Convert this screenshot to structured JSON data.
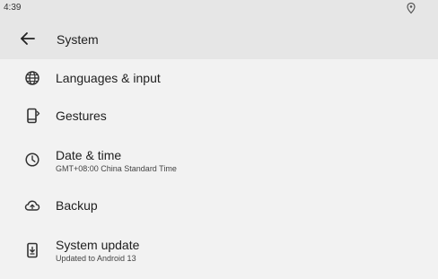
{
  "status_bar": {
    "time": "4:39",
    "location_icon": "location-icon"
  },
  "app_bar": {
    "back_icon": "back-arrow-icon",
    "title": "System"
  },
  "settings": {
    "items": [
      {
        "label": "Languages & input",
        "summary": "",
        "icon": "globe-icon"
      },
      {
        "label": "Gestures",
        "summary": "",
        "icon": "gestures-phone-icon"
      },
      {
        "label": "Date & time",
        "summary": "GMT+08:00 China Standard Time",
        "icon": "clock-icon"
      },
      {
        "label": "Backup",
        "summary": "",
        "icon": "cloud-backup-icon"
      },
      {
        "label": "System update",
        "summary": "Updated to Android 13",
        "icon": "system-update-icon"
      }
    ]
  },
  "colors": {
    "background": "#f2f2f2",
    "app_bar": "#e6e6e6",
    "text_primary": "#1f1f1f",
    "text_secondary": "#444444",
    "icon": "#333333"
  }
}
